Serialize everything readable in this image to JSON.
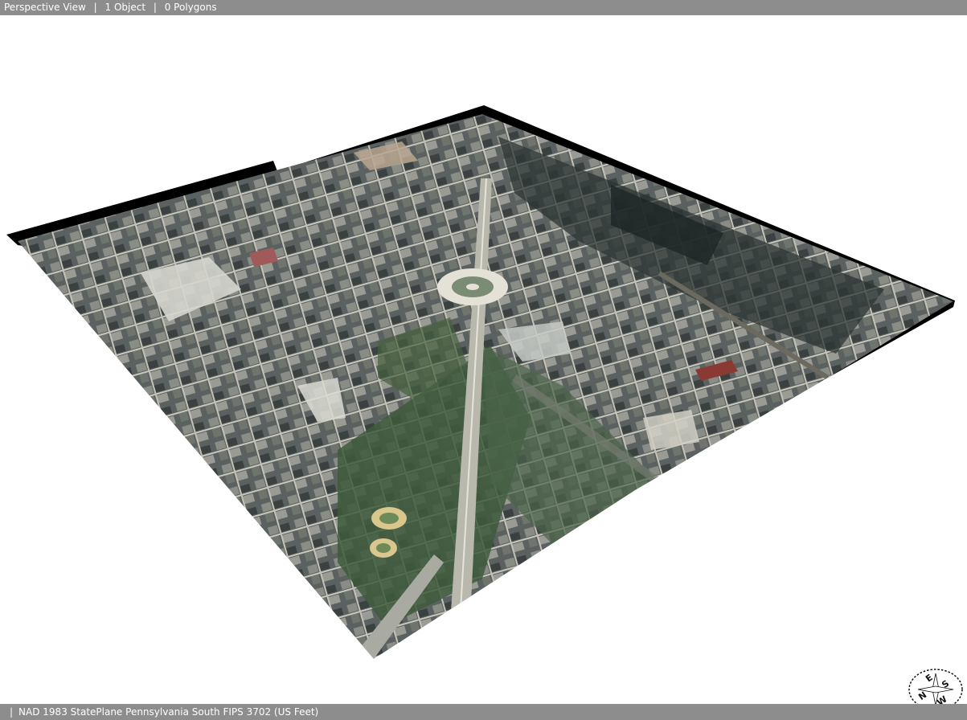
{
  "status_top": {
    "view_mode": "Perspective View",
    "separator": "|",
    "object_count": "1 Object",
    "polygon_count": "0 Polygons"
  },
  "status_bottom": {
    "separator": "|",
    "coordinate_system": "NAD 1983 StatePlane Pennsylvania South FIPS 3702 (US Feet)"
  },
  "compass": {
    "icon": "compass-rose-icon",
    "letters": {
      "north": "N",
      "east": "E",
      "south": "S",
      "west": "W"
    }
  },
  "colors": {
    "status_bar_bg": "#8d8d8d",
    "status_text": "#ffffff",
    "viewport_bg": "#ffffff",
    "terrain_edge": "#000000"
  }
}
